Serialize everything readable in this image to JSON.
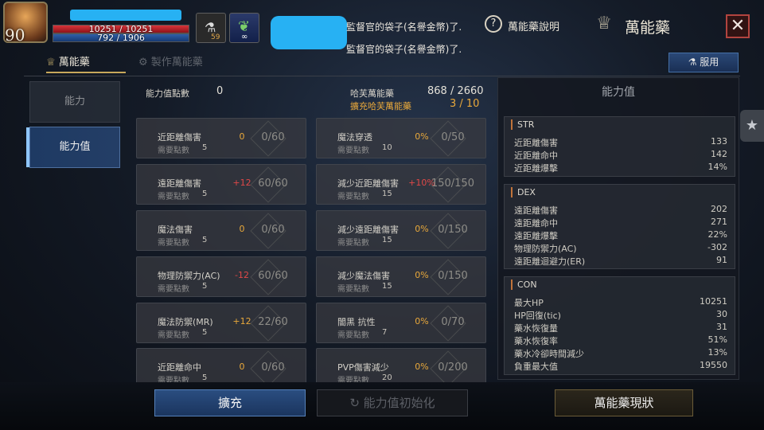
{
  "player": {
    "level": "90",
    "hp": "10251 / 10251",
    "mp": "792 / 1906",
    "buff_count": "59"
  },
  "messages": [
    "監督官的袋子(名譽金幣)了.",
    "監督官的袋子(名譽金幣)了."
  ],
  "header": {
    "help_label": "萬能藥說明",
    "title": "萬能藥",
    "close_label": "✕"
  },
  "tabs": [
    {
      "label": "萬能藥"
    },
    {
      "label": "製作萬能藥"
    }
  ],
  "use_button": "服用",
  "nav": [
    {
      "label": "能力"
    },
    {
      "label": "能力值"
    }
  ],
  "summary": {
    "points_label": "能力值點數",
    "points_value": "0",
    "capacity_label": "哈芙萬能藥",
    "capacity_value": "868 / 2660",
    "expand_label": "擴充哈芙萬能藥",
    "expand_value": "3 / 10"
  },
  "need_label": "需要點數",
  "left_cards": [
    {
      "name": "近距離傷害",
      "cost": "5",
      "bonus": "0",
      "value": "0/60"
    },
    {
      "name": "遠距離傷害",
      "cost": "5",
      "bonus": "+12",
      "value": "60/60"
    },
    {
      "name": "魔法傷害",
      "cost": "5",
      "bonus": "0",
      "value": "0/60"
    },
    {
      "name": "物理防禦力(AC)",
      "cost": "5",
      "bonus": "-12",
      "value": "60/60"
    },
    {
      "name": "魔法防禦(MR)",
      "cost": "5",
      "bonus": "+12",
      "value": "22/60"
    },
    {
      "name": "近距離命中",
      "cost": "5",
      "bonus": "0",
      "value": "0/60"
    }
  ],
  "right_cards": [
    {
      "name": "魔法穿透",
      "cost": "10",
      "bonus": "0%",
      "value": "0/50"
    },
    {
      "name": "減少近距離傷害",
      "cost": "15",
      "bonus": "+10%",
      "value": "150/150"
    },
    {
      "name": "減少遠距離傷害",
      "cost": "15",
      "bonus": "0%",
      "value": "0/150"
    },
    {
      "name": "減少魔法傷害",
      "cost": "15",
      "bonus": "0%",
      "value": "0/150"
    },
    {
      "name": "闇黑 抗性",
      "cost": "7",
      "bonus": "0%",
      "value": "0/70"
    },
    {
      "name": "PVP傷害減少",
      "cost": "20",
      "bonus": "0%",
      "value": "0/200"
    }
  ],
  "stats_panel": {
    "title": "能力值",
    "sections": [
      {
        "head": "STR",
        "rows": [
          [
            "近距離傷害",
            "133"
          ],
          [
            "近距離命中",
            "142"
          ],
          [
            "近距離爆擊",
            "14%"
          ]
        ]
      },
      {
        "head": "DEX",
        "rows": [
          [
            "遠距離傷害",
            "202"
          ],
          [
            "遠距離命中",
            "271"
          ],
          [
            "遠距離爆擊",
            "22%"
          ],
          [
            "物理防禦力(AC)",
            "-302"
          ],
          [
            "遠距離迴避力(ER)",
            "91"
          ]
        ]
      },
      {
        "head": "CON",
        "rows": [
          [
            "最大HP",
            "10251"
          ],
          [
            "HP回復(tic)",
            "30"
          ],
          [
            "藥水恢復量",
            "31"
          ],
          [
            "藥水恢復率",
            "51%"
          ],
          [
            "藥水冷卻時間減少",
            "13%"
          ],
          [
            "負重最大值",
            "19550"
          ]
        ]
      }
    ]
  },
  "bottom": {
    "expand": "擴充",
    "reset": "能力值初始化",
    "status": "萬能藥現狀"
  },
  "colors": {
    "accent": "#c7a85b",
    "negative": "#e04848",
    "bonus": "#e8a83b",
    "primary_button": "#2a4d80"
  }
}
